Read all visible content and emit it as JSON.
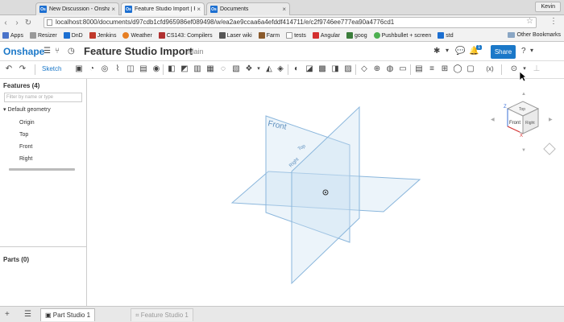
{
  "browser": {
    "tabs": [
      {
        "label": "New Discussion - Onshape",
        "favicon": "Os"
      },
      {
        "label": "Feature Studio Import | Pu",
        "favicon": "Os"
      },
      {
        "label": "Documents",
        "favicon": "Os"
      }
    ],
    "user": "Kevin",
    "url": "localhost:8000/documents/d97cdb1cfd965986ef089498/w/ea2ae9ccaa6a4efddf414711/e/c2f9746ee777ea90a4776cd1",
    "bookmarks": [
      {
        "label": "Apps",
        "color": "#4a73c9"
      },
      {
        "label": "Resizer",
        "color": "#999999"
      },
      {
        "label": "DnD",
        "color": "#1c6fd1"
      },
      {
        "label": "Jenkins",
        "color": "#c0392b"
      },
      {
        "label": "Weather",
        "color": "#e67e22"
      },
      {
        "label": "CS143: Compilers",
        "color": "#b03030"
      },
      {
        "label": "Laser wiki",
        "color": "#555555"
      },
      {
        "label": "Farm",
        "color": "#8a5a2b"
      },
      {
        "label": "tests",
        "color": "#777777"
      },
      {
        "label": "Angular",
        "color": "#d32f2f"
      },
      {
        "label": "goog",
        "color": "#3b7d3b"
      },
      {
        "label": "Pushbullet + screen",
        "color": "#4caf50"
      },
      {
        "label": "std",
        "color": "#1c6fd1"
      }
    ],
    "other_bookmarks": "Other Bookmarks"
  },
  "app": {
    "logo": "Onshape",
    "document_title": "Feature Studio Import",
    "branch": "Main",
    "notification_count": "1",
    "share_label": "Share",
    "accent": "#1b78c8"
  },
  "toolbar": {
    "sketch_label": "Sketch"
  },
  "feature_panel": {
    "title": "Features (4)",
    "filter_placeholder": "Filter by name or type",
    "group_label": "Default geometry",
    "features": [
      "Origin",
      "Top",
      "Front",
      "Right"
    ],
    "parts_title": "Parts (0)"
  },
  "viewport": {
    "plane_labels": {
      "front": "Front",
      "top": "Top",
      "right": "Right"
    }
  },
  "navcube": {
    "axis_z": "Z",
    "axis_x": "X",
    "face_front": "Front",
    "face_top": "Top",
    "face_right": "Right"
  },
  "bottom_tabs": [
    {
      "label": "Part Studio 1",
      "active": true
    },
    {
      "label": "Feature Studio 1",
      "active": false
    }
  ]
}
